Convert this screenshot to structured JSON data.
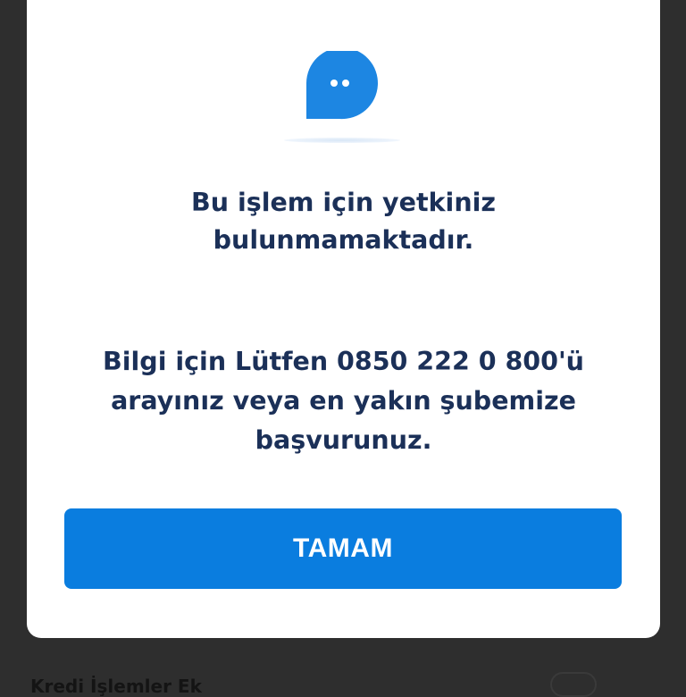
{
  "background": {
    "partial_text": "Kredi İşlemler Ek",
    "color": "#2e2e2e"
  },
  "dialog": {
    "icon": "chat-bubble-icon",
    "title_lines": [
      "Bu işlem için yetkiniz",
      "bulunmamaktadır."
    ],
    "message_lines": [
      "Bilgi için Lütfen 0850 222 0 800'ü",
      "arayınız veya en yakın şubemize",
      "başvurunuz."
    ],
    "ok_label": "TAMAM"
  },
  "colors": {
    "accent": "#0a7ddf",
    "text": "#1b3058",
    "dialog_bg": "#ffffff"
  }
}
